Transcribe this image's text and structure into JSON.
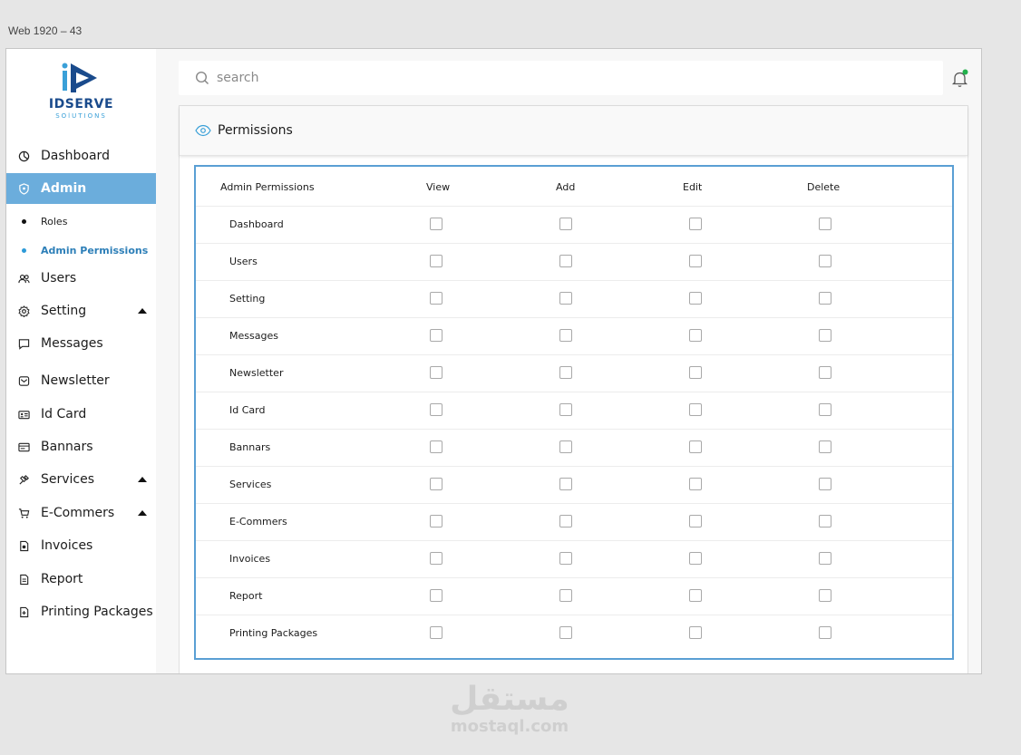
{
  "frame_label": "Web 1920 – 43",
  "brand": {
    "name": "IDSERVE",
    "tagline": "SOlUTIONS",
    "primary_color": "#1a4b8c",
    "accent_color": "#3aa0d8"
  },
  "sidebar": {
    "active_color": "#6baddc",
    "items": [
      {
        "label": "Dashboard",
        "icon": "dashboard-icon"
      },
      {
        "label": "Admin",
        "icon": "admin-shield-icon",
        "active": true
      },
      {
        "label": "Roles",
        "sub": true
      },
      {
        "label": "Admin Permissions",
        "sub": true,
        "active": true
      },
      {
        "label": "Users",
        "icon": "users-icon"
      },
      {
        "label": "Setting",
        "icon": "gear-icon",
        "expandable": true
      },
      {
        "label": "Messages",
        "icon": "message-icon"
      },
      {
        "label": "Newsletter",
        "icon": "newsletter-icon"
      },
      {
        "label": "Id Card",
        "icon": "id-card-icon"
      },
      {
        "label": "Bannars",
        "icon": "banner-icon"
      },
      {
        "label": "Services",
        "icon": "services-icon",
        "expandable": true
      },
      {
        "label": "E-Commers",
        "icon": "cart-icon",
        "expandable": true
      },
      {
        "label": "Invoices",
        "icon": "invoice-icon"
      },
      {
        "label": "Report",
        "icon": "report-icon"
      },
      {
        "label": "Printing Packages",
        "icon": "package-icon"
      }
    ]
  },
  "search": {
    "placeholder": "search",
    "value": ""
  },
  "notification": {
    "icon": "bell-icon",
    "status_color": "#22b14c"
  },
  "card": {
    "title": "Permissions",
    "icon": "eye-icon"
  },
  "table": {
    "headers": [
      "Admin Permissions",
      "View",
      "Add",
      "Edit",
      "Delete"
    ],
    "rows": [
      {
        "label": "Dashboard",
        "view": false,
        "add": false,
        "edit": false,
        "delete": false
      },
      {
        "label": "Users",
        "view": false,
        "add": false,
        "edit": false,
        "delete": false
      },
      {
        "label": "Setting",
        "view": false,
        "add": false,
        "edit": false,
        "delete": false
      },
      {
        "label": "Messages",
        "view": false,
        "add": false,
        "edit": false,
        "delete": false
      },
      {
        "label": "Newsletter",
        "view": false,
        "add": false,
        "edit": false,
        "delete": false
      },
      {
        "label": "Id Card",
        "view": false,
        "add": false,
        "edit": false,
        "delete": false
      },
      {
        "label": "Bannars",
        "view": false,
        "add": false,
        "edit": false,
        "delete": false
      },
      {
        "label": "Services",
        "view": false,
        "add": false,
        "edit": false,
        "delete": false
      },
      {
        "label": "E-Commers",
        "view": false,
        "add": false,
        "edit": false,
        "delete": false
      },
      {
        "label": "Invoices",
        "view": false,
        "add": false,
        "edit": false,
        "delete": false
      },
      {
        "label": "Report",
        "view": false,
        "add": false,
        "edit": false,
        "delete": false
      },
      {
        "label": "Printing Packages",
        "view": false,
        "add": false,
        "edit": false,
        "delete": false
      }
    ]
  },
  "watermark": {
    "arabic": "مستقل",
    "latin": "mostaql.com"
  }
}
